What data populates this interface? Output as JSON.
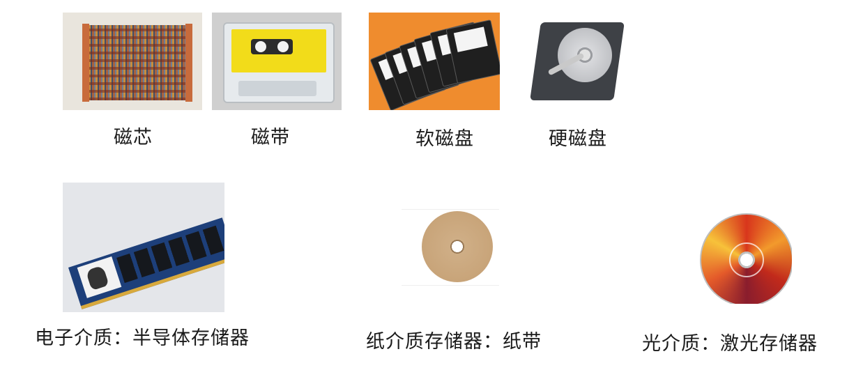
{
  "captions": {
    "magnetic_core": "磁芯",
    "magnetic_tape": "磁带",
    "floppy_disk": "软磁盘",
    "hard_disk": "硬磁盘",
    "semiconductor": "电子介质：半导体存储器",
    "paper": "纸介质存储器：纸带",
    "optical": "光介质：激光存储器"
  },
  "images": {
    "magnetic_core": "magnetic-core-memory-photo",
    "magnetic_tape": "cassette-tape-photo",
    "floppy_disk": "floppy-disks-photo",
    "hard_disk": "hard-disk-drive-photo",
    "semiconductor": "ram-module-photo",
    "paper": "paper-tape-roll-photo",
    "optical": "dvd-disc-photo"
  }
}
